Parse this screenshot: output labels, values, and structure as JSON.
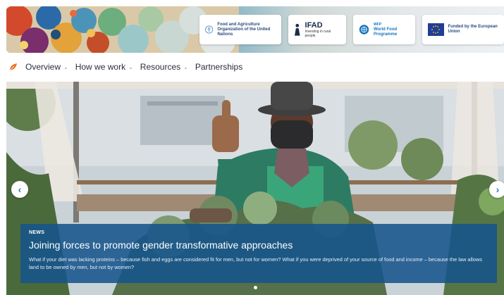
{
  "partners": {
    "fao": {
      "name": "Food and Agriculture Organization of the United Nations"
    },
    "ifad": {
      "name": "IFAD",
      "tagline": "Investing in rural people"
    },
    "wfp": {
      "abbr": "WFP",
      "name": "World Food Programme"
    },
    "eu": {
      "name": "Funded by the European Union"
    }
  },
  "nav": {
    "items": [
      {
        "label": "Overview",
        "has_dropdown": true
      },
      {
        "label": "How we work",
        "has_dropdown": true
      },
      {
        "label": "Resources",
        "has_dropdown": true
      },
      {
        "label": "Partnerships",
        "has_dropdown": false
      }
    ]
  },
  "hero": {
    "tag": "NEWS",
    "title": "Joining forces to promote gender transformative approaches",
    "body": "What if your diet was lacking proteins – because fish and eggs are considered fit for men, but not for women? What if you were deprived of your source of food and income – because the law allows land to be owned by men, but not by women?",
    "slide_count": 1,
    "active_slide": 1
  },
  "icons": {
    "prev": "chevron-left-icon",
    "next": "chevron-right-icon",
    "dropdown": "chevron-down-icon",
    "home": "leaf-logo-icon"
  },
  "colors": {
    "caption_bg": "#16548c",
    "arrow": "#2a78c5",
    "logo_orange": "#e8701d",
    "eu_blue": "#1f3f97",
    "wfp_blue": "#1a75bc",
    "fao_blue": "#3a7fc1"
  }
}
